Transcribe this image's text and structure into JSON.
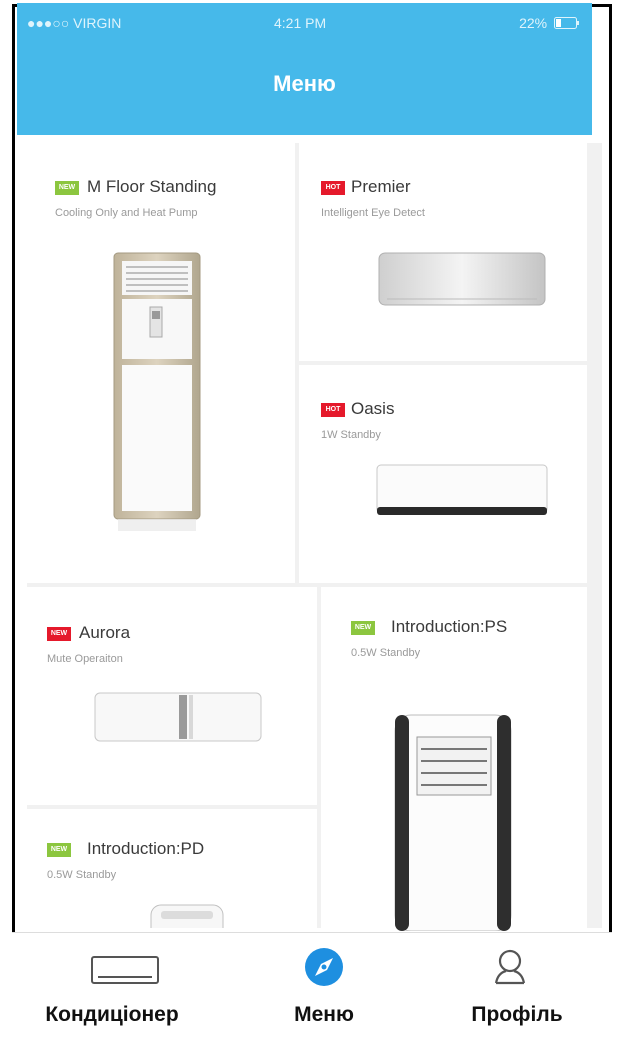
{
  "status_bar": {
    "carrier": "●●●○○ VIRGIN",
    "time": "4:21 PM",
    "battery": "22%"
  },
  "header": {
    "title": "Меню"
  },
  "products": [
    {
      "name": "M Floor Standing",
      "subtitle": "Cooling Only and Heat Pump",
      "badge": "NEW",
      "badge_color": "#8cc63f"
    },
    {
      "name": "Premier",
      "subtitle": "Intelligent Eye Detect",
      "badge": "HOT",
      "badge_color": "#e5192b"
    },
    {
      "name": "Oasis",
      "subtitle": "1W Standby",
      "badge": "HOT",
      "badge_color": "#e5192b"
    },
    {
      "name": "Aurora",
      "subtitle": "Mute Operaiton",
      "badge": "NEW",
      "badge_color": "#e5192b"
    },
    {
      "name": "Introduction:PS",
      "subtitle": "0.5W Standby",
      "badge": "NEW",
      "badge_color": "#8cc63f"
    },
    {
      "name": "Introduction:PD",
      "subtitle": "0.5W Standby",
      "badge": "NEW",
      "badge_color": "#8cc63f"
    }
  ],
  "tabs": [
    {
      "label": "Кондиціонер",
      "icon": "air-conditioner-icon",
      "active": false
    },
    {
      "label": "Меню",
      "icon": "compass-icon",
      "active": true
    },
    {
      "label": "Профіль",
      "icon": "user-icon",
      "active": false
    }
  ],
  "colors": {
    "header": "#46b9ea",
    "new_badge": "#8cc63f",
    "hot_badge": "#e5192b"
  }
}
